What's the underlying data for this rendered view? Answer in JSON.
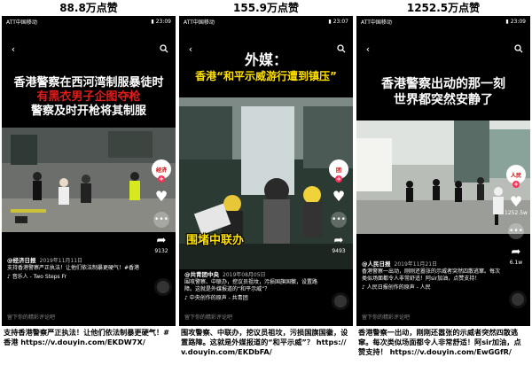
{
  "panels": [
    {
      "likes": "88.8万点赞",
      "status": {
        "carrier": "ATT中国移动",
        "time": "23:09"
      },
      "headline": [
        "香港警察在西河湾制服暴徒时",
        "有黑衣男子企图夺枪",
        "警察及时开枪将其制服"
      ],
      "author": "@经济日报",
      "date": "2019年11月11日",
      "desc": "支持香港警察严正执法！让他们依法制暴更硬气！#香港",
      "music": "音乐人 - Two Steps Fr",
      "side_counts": [
        "",
        "",
        "9132"
      ],
      "comment_hint": "留下你的精彩评论吧",
      "caption": "支持香港警察严正执法！让他们依法制暴更硬气！#香港 https://v.douyin.com/EKDW7X/"
    },
    {
      "likes": "155.9万点赞",
      "status": {
        "carrier": "ATT中国移动",
        "time": "23:07"
      },
      "headline": [
        "外媒：",
        "香港“和平示威游行遭到镇压”"
      ],
      "video_label": "围堵中联办",
      "author": "@共青团中央",
      "date": "2019年08月05日",
      "desc": "围攻警察、中联办，挖议员祖坟，污损国旗国徽，设置路障。这就是外媒报道的“和平示威”？",
      "music": "中央创作的原声 - 共青团",
      "side_counts": [
        "",
        "",
        "9493"
      ],
      "comment_hint": "留下你的精彩评论吧",
      "caption": "围攻警察、中联办，挖议员祖坟，污损国旗国徽，设置路障。这就是外媒报道的“和平示威”？ https://v.douyin.com/EKDbFA/"
    },
    {
      "likes": "1252.5万点赞",
      "status": {
        "carrier": "ATT中国移动",
        "time": "23:09"
      },
      "headline": [
        "香港警察出动的那一刻",
        "世界都突然安静了"
      ],
      "author": "@人民日报",
      "date": "2019年11月21日",
      "desc": "香港警察一出动，刚刚还嚣张的示威者突然四散逃窜。每次类似场面都令人非常舒适！阿sir加油，点赞支持！",
      "music": "人民日报创作的原声 - 人民",
      "side_counts": [
        "1252.5w",
        "",
        "6.1w"
      ],
      "comment_hint": "留下你的精彩评论吧",
      "caption": "香港警察一出动，刚刚还嚣张的示威者突然四散逃窜。每次类似场面都令人非常舒适！阿sir加油，点赞支持！ https://v.douyin.com/EwGGfR/"
    }
  ],
  "icons": {
    "back": "chevron-left-icon",
    "search": "search-icon",
    "heart": "heart-icon",
    "comment": "comment-dots-icon",
    "share": "share-icon",
    "music": "music-note-icon",
    "disc": "music-disc-icon"
  }
}
